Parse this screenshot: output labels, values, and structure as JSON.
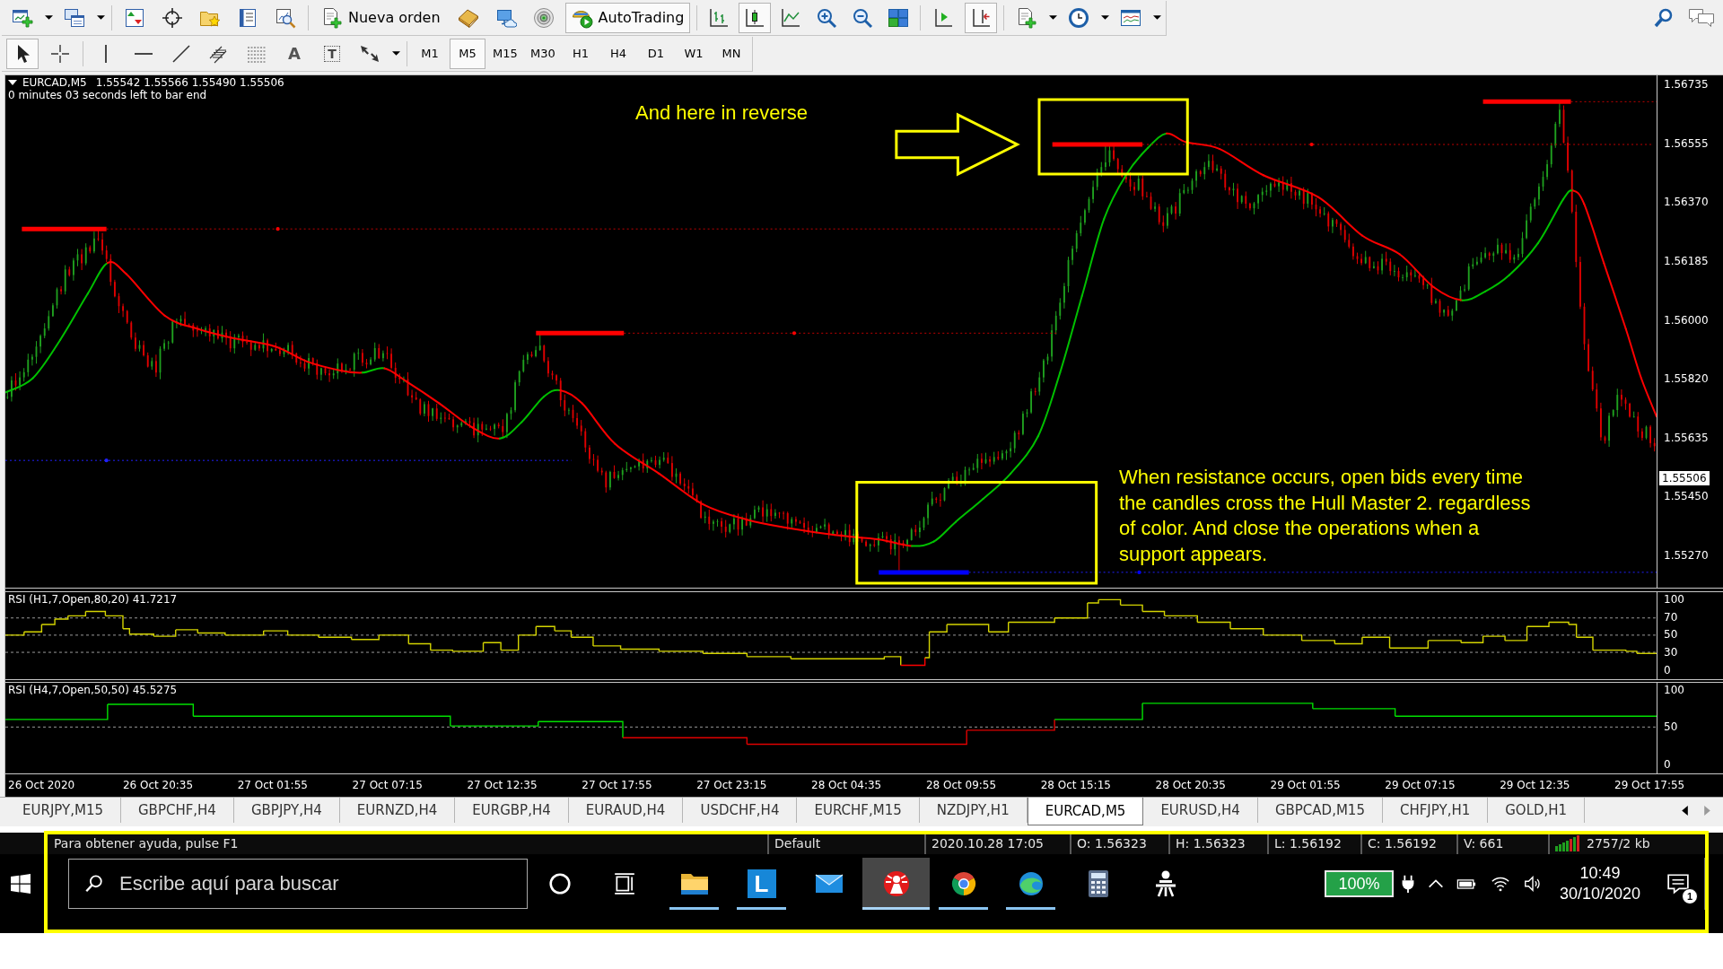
{
  "toolbar": {
    "new_order_button": {
      "label": "Nueva orden"
    },
    "autotrading_button": {
      "label": "AutoTrading",
      "on": true
    },
    "chart_types": [
      {
        "kind": "bars",
        "selected": false
      },
      {
        "kind": "candles",
        "selected": true
      },
      {
        "kind": "line",
        "selected": false
      }
    ],
    "auto_scroll": {
      "on": false
    },
    "chart_shift": {
      "on": true
    }
  },
  "drawing_toolbar": {
    "tools": [
      {
        "kind": "cursor",
        "selected": true
      },
      {
        "kind": "crosshair",
        "selected": false
      },
      {
        "kind": "vertical_line",
        "selected": false
      },
      {
        "kind": "horizontal_line",
        "selected": false
      },
      {
        "kind": "trendline",
        "selected": false
      },
      {
        "kind": "channel",
        "selected": false
      },
      {
        "kind": "fibonacci",
        "selected": false
      },
      {
        "kind": "text",
        "label": "A",
        "selected": false
      },
      {
        "kind": "text_label",
        "label": "T",
        "selected": false
      },
      {
        "kind": "arrows",
        "selected": false
      }
    ],
    "timeframes": [
      {
        "label": "M1",
        "selected": false
      },
      {
        "label": "M5",
        "selected": true
      },
      {
        "label": "M15",
        "selected": false
      },
      {
        "label": "M30",
        "selected": false
      },
      {
        "label": "H1",
        "selected": false
      },
      {
        "label": "H4",
        "selected": false
      },
      {
        "label": "D1",
        "selected": false
      },
      {
        "label": "W1",
        "selected": false
      },
      {
        "label": "MN",
        "selected": false
      }
    ]
  },
  "chart": {
    "symbol": "EURCAD,M5",
    "prices": "1.55542 1.55566 1.55490 1.55506",
    "countdown": "0 minutes 03 seconds left to bar end",
    "annotation": "And here in reverse",
    "note": [
      "When resistance occurs, open bids every time",
      "the candles cross the Hull Master 2. regardless",
      "of color. And close the operations when a",
      "support appears."
    ],
    "price_axis": [
      "1.56735",
      "1.56555",
      "1.56370",
      "1.56185",
      "1.56000",
      "1.55820",
      "1.55635",
      "1.55450",
      "1.55270"
    ],
    "current_price": "1.55506",
    "indicators": [
      {
        "label": "RSI (H1,7,Open,80,20) 41.7217",
        "axis": [
          "100",
          "70",
          "50",
          "30",
          "0"
        ]
      },
      {
        "label": "RSI (H4,7,Open,50,50) 45.5275",
        "axis": [
          "100",
          "50",
          "0"
        ]
      }
    ],
    "time_axis": [
      "26 Oct 2020",
      "26 Oct 20:35",
      "27 Oct 01:55",
      "27 Oct 07:15",
      "27 Oct 12:35",
      "27 Oct 17:55",
      "27 Oct 23:15",
      "28 Oct 04:35",
      "28 Oct 09:55",
      "28 Oct 15:15",
      "28 Oct 20:35",
      "29 Oct 01:55",
      "29 Oct 07:15",
      "29 Oct 12:35",
      "29 Oct 17:55"
    ]
  },
  "tabs": [
    {
      "label": "EURJPY,M15",
      "selected": false
    },
    {
      "label": "GBPCHF,H4",
      "selected": false
    },
    {
      "label": "GBPJPY,H4",
      "selected": false
    },
    {
      "label": "EURNZD,H4",
      "selected": false
    },
    {
      "label": "EURGBP,H4",
      "selected": false
    },
    {
      "label": "EURAUD,H4",
      "selected": false
    },
    {
      "label": "USDCHF,H4",
      "selected": false
    },
    {
      "label": "EURCHF,M15",
      "selected": false
    },
    {
      "label": "NZDJPY,H1",
      "selected": false
    },
    {
      "label": "EURCAD,M5",
      "selected": true
    },
    {
      "label": "EURUSD,H4",
      "selected": false
    },
    {
      "label": "GBPCAD,M15",
      "selected": false
    },
    {
      "label": "CHFJPY,H1",
      "selected": false
    },
    {
      "label": "GOLD,H1",
      "selected": false
    }
  ],
  "status_bar": {
    "help": "Para obtener ayuda, pulse F1",
    "profile": "Default",
    "time": "2020.10.28 17:05",
    "open": "O: 1.56323",
    "high": "H: 1.56323",
    "low": "L: 1.56192",
    "close": "C: 1.56192",
    "volume": "V: 661",
    "traffic": "2757/2 kb"
  },
  "taskbar": {
    "search": {
      "placeholder": "Escribe aquí para buscar"
    },
    "apps": [
      {
        "kind": "file_explorer",
        "running": true,
        "selected": false
      },
      {
        "kind": "letter_tile",
        "label": "L",
        "running": true,
        "selected": false
      },
      {
        "kind": "mail",
        "running": false,
        "selected": false
      },
      {
        "kind": "emblem",
        "running": true,
        "selected": true
      },
      {
        "kind": "round_logo",
        "running": true,
        "selected": false
      },
      {
        "kind": "wave_logo",
        "running": true,
        "selected": false
      },
      {
        "kind": "calculator",
        "running": false,
        "selected": false
      },
      {
        "kind": "figure",
        "running": false,
        "selected": false
      }
    ],
    "battery": "100%",
    "time": "10:49",
    "date": "30/10/2020",
    "notifications": "1"
  }
}
